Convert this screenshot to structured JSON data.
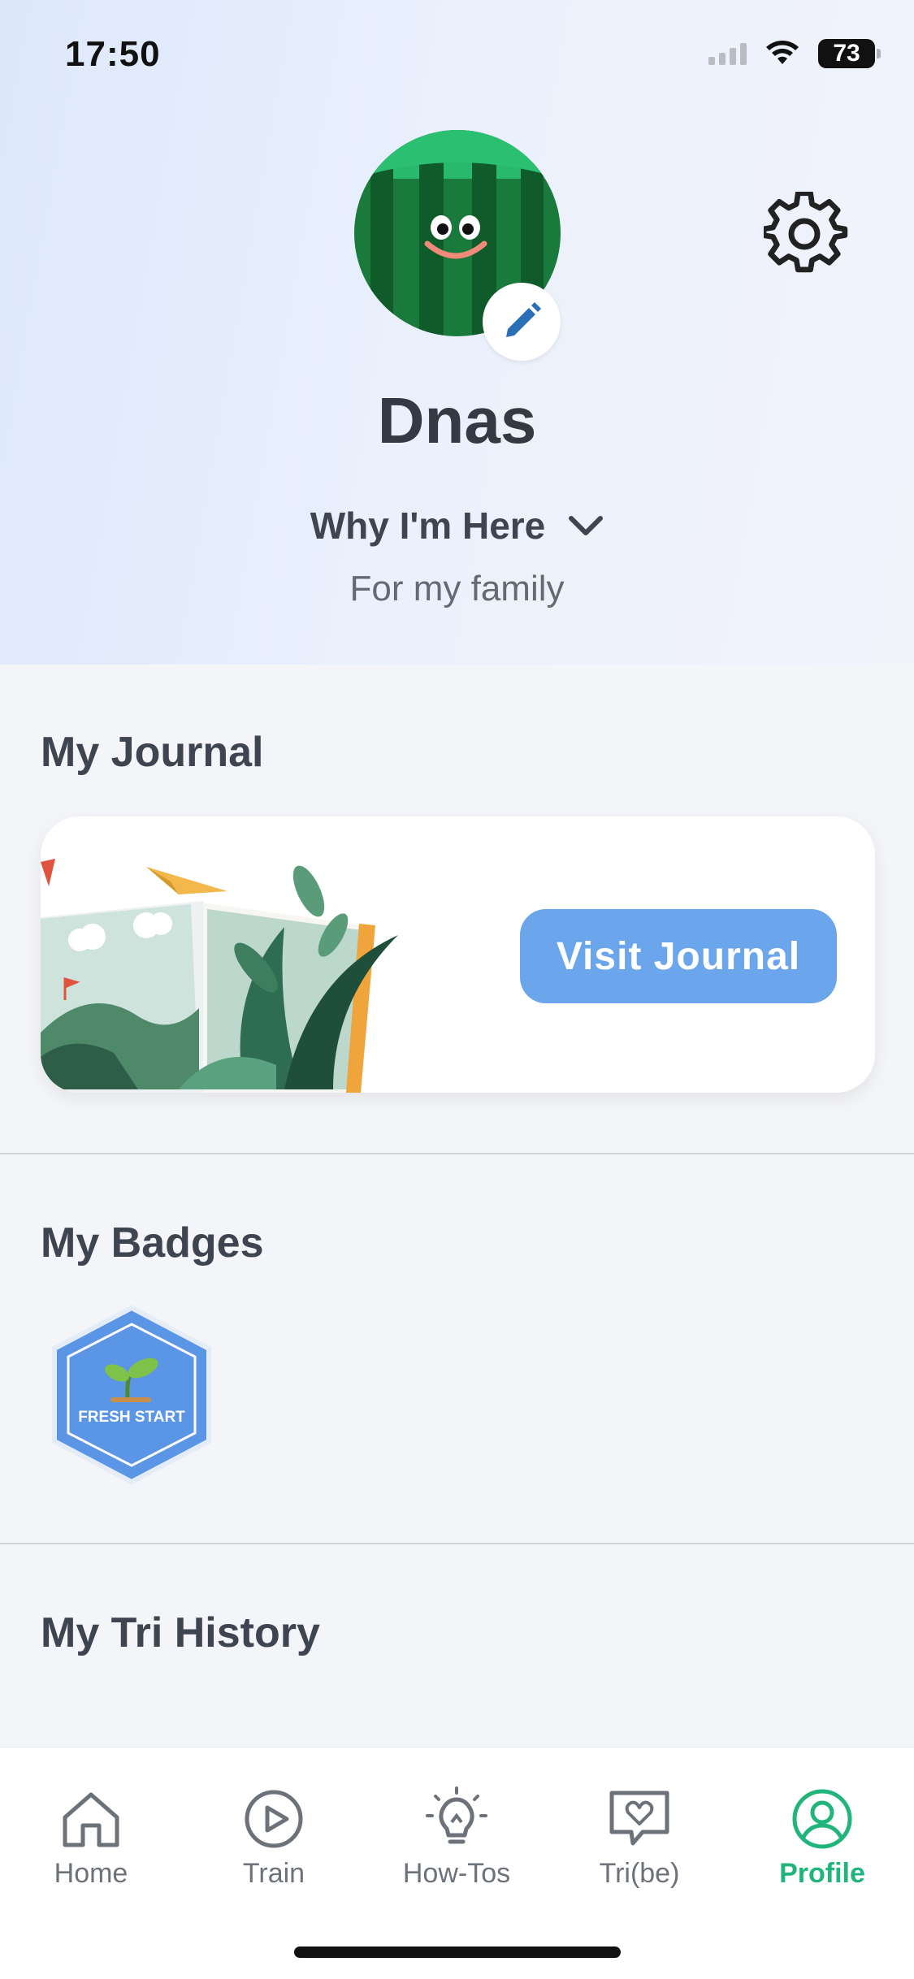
{
  "status_bar": {
    "time": "17:50",
    "battery": "73"
  },
  "profile": {
    "name": "Dnas",
    "why_label": "Why I'm Here",
    "why_value": "For my family"
  },
  "journal": {
    "title": "My Journal",
    "button_label": "Visit Journal"
  },
  "badges": {
    "title": "My Badges",
    "items": [
      {
        "label": "FRESH START",
        "icon": "sprout-icon"
      }
    ]
  },
  "history": {
    "title": "My Tri History"
  },
  "nav": {
    "items": [
      {
        "label": "Home",
        "icon": "home-icon"
      },
      {
        "label": "Train",
        "icon": "play-circle-icon"
      },
      {
        "label": "How-Tos",
        "icon": "lightbulb-icon"
      },
      {
        "label": "Tri(be)",
        "icon": "heart-chat-icon"
      },
      {
        "label": "Profile",
        "icon": "profile-icon",
        "active": true
      }
    ]
  },
  "colors": {
    "accent": "#21b57c",
    "button": "#6ba6ec",
    "badge": "#5b95e5"
  }
}
